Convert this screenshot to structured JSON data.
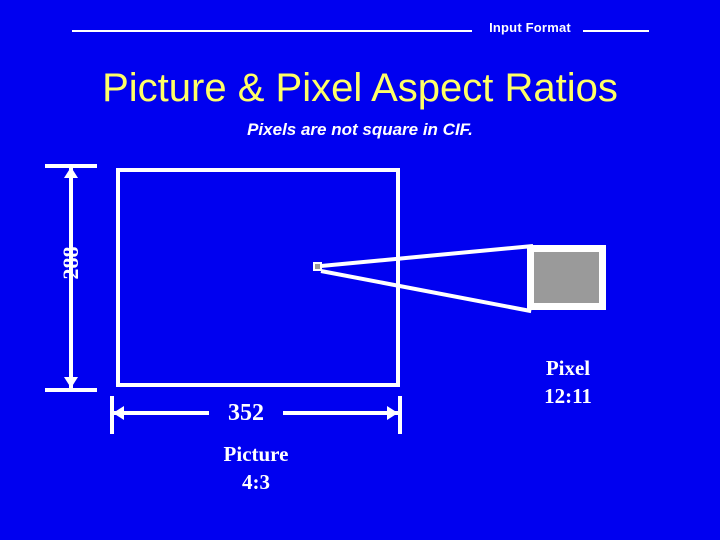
{
  "header": {
    "label": "Input Format"
  },
  "title": "Picture & Pixel Aspect Ratios",
  "subtitle": "Pixels are not square in CIF.",
  "diagram": {
    "height_label": "288",
    "width_label": "352",
    "picture_caption_line1": "Picture",
    "picture_caption_line2": "4:3",
    "pixel_caption_line1": "Pixel",
    "pixel_caption_line2": "12:11"
  },
  "colors": {
    "background": "#0000f0",
    "title": "#ffff66",
    "text": "#ffffff",
    "pixel_fill": "#9a9a9a"
  }
}
